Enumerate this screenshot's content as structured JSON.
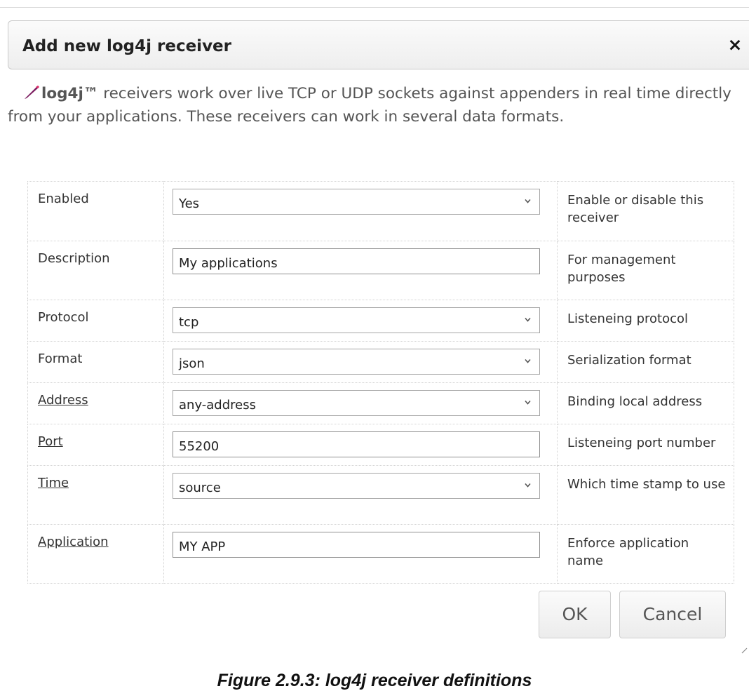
{
  "dialog": {
    "title": "Add new log4j receiver",
    "close_icon": "×"
  },
  "intro": {
    "brand": "log4j™",
    "text": " receivers work over live TCP or UDP sockets against appenders in real time directly from your applications. These receivers can work in several data formats."
  },
  "form": {
    "rows": [
      {
        "label": "Enabled",
        "link": false,
        "type": "select",
        "value": "Yes",
        "hint": "Enable or disable this receiver"
      },
      {
        "label": "Description",
        "link": false,
        "type": "input",
        "value": "My applications",
        "hint": "For management purposes"
      },
      {
        "label": "Protocol",
        "link": false,
        "type": "select",
        "value": "tcp",
        "hint": "Listeneing protocol"
      },
      {
        "label": "Format",
        "link": false,
        "type": "select",
        "value": "json",
        "hint": "Serialization format"
      },
      {
        "label": "Address",
        "link": true,
        "type": "select",
        "value": "any-address",
        "hint": "Binding local address"
      },
      {
        "label": "Port",
        "link": true,
        "type": "input",
        "value": "55200",
        "hint": "Listeneing port number"
      },
      {
        "label": "Time",
        "link": true,
        "type": "select",
        "value": "source",
        "hint": "Which time stamp to use"
      },
      {
        "label": "Application",
        "link": true,
        "type": "input",
        "value": "MY APP",
        "hint": "Enforce application name"
      }
    ]
  },
  "buttons": {
    "ok": "OK",
    "cancel": "Cancel"
  },
  "caption": "Figure 2.9.3: log4j receiver definitions",
  "colors": {
    "quill": "#7a1a5e",
    "quill_tip": "#e0306a"
  }
}
